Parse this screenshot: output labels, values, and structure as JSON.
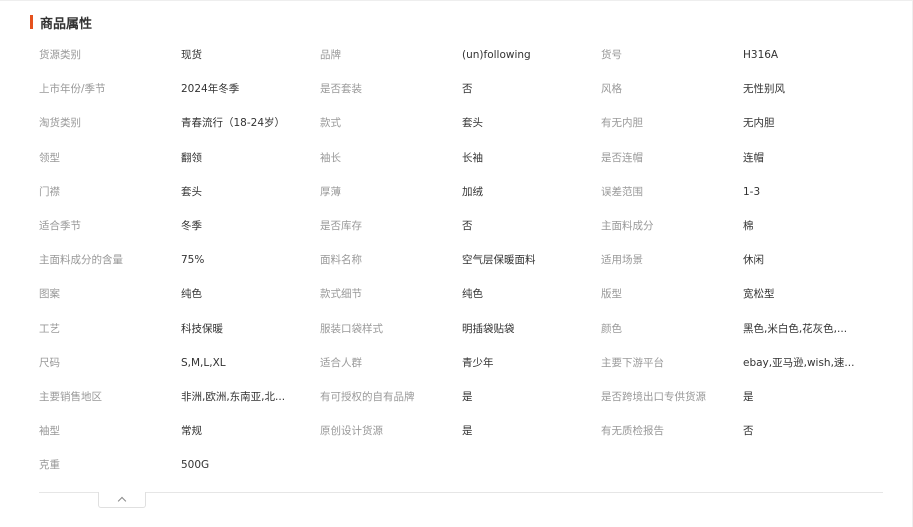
{
  "section": {
    "title": "商品属性",
    "accent_color": "#e5511d"
  },
  "attributes": [
    [
      {
        "label": "货源类别",
        "value": "现货"
      },
      {
        "label": "品牌",
        "value": "(un)following"
      },
      {
        "label": "货号",
        "value": "H316A"
      }
    ],
    [
      {
        "label": "上市年份/季节",
        "value": "2024年冬季"
      },
      {
        "label": "是否套装",
        "value": "否"
      },
      {
        "label": "风格",
        "value": "无性别风"
      }
    ],
    [
      {
        "label": "淘货类别",
        "value": "青春流行（18-24岁）"
      },
      {
        "label": "款式",
        "value": "套头"
      },
      {
        "label": "有无内胆",
        "value": "无内胆"
      }
    ],
    [
      {
        "label": "领型",
        "value": "翻领"
      },
      {
        "label": "袖长",
        "value": "长袖"
      },
      {
        "label": "是否连帽",
        "value": "连帽"
      }
    ],
    [
      {
        "label": "门襟",
        "value": "套头"
      },
      {
        "label": "厚薄",
        "value": "加绒"
      },
      {
        "label": "误差范围",
        "value": "1-3"
      }
    ],
    [
      {
        "label": "适合季节",
        "value": "冬季"
      },
      {
        "label": "是否库存",
        "value": "否"
      },
      {
        "label": "主面料成分",
        "value": "棉"
      }
    ],
    [
      {
        "label": "主面料成分的含量",
        "value": "75%"
      },
      {
        "label": "面料名称",
        "value": "空气层保暖面料"
      },
      {
        "label": "适用场景",
        "value": "休闲"
      }
    ],
    [
      {
        "label": "图案",
        "value": "纯色"
      },
      {
        "label": "款式细节",
        "value": "纯色"
      },
      {
        "label": "版型",
        "value": "宽松型"
      }
    ],
    [
      {
        "label": "工艺",
        "value": "科技保暖"
      },
      {
        "label": "服装口袋样式",
        "value": "明插袋贴袋"
      },
      {
        "label": "颜色",
        "value": "黑色,米白色,花灰色,..."
      }
    ],
    [
      {
        "label": "尺码",
        "value": "S,M,L,XL"
      },
      {
        "label": "适合人群",
        "value": "青少年"
      },
      {
        "label": "主要下游平台",
        "value": "ebay,亚马逊,wish,速..."
      }
    ],
    [
      {
        "label": "主要销售地区",
        "value": "非洲,欧洲,东南亚,北..."
      },
      {
        "label": "有可授权的自有品牌",
        "value": "是"
      },
      {
        "label": "是否跨境出口专供货源",
        "value": "是"
      }
    ],
    [
      {
        "label": "袖型",
        "value": "常规"
      },
      {
        "label": "原创设计货源",
        "value": "是"
      },
      {
        "label": "有无质检报告",
        "value": "否"
      }
    ],
    [
      {
        "label": "克重",
        "value": "500G"
      }
    ]
  ],
  "collapse": {
    "icon": "chevron-up-icon"
  }
}
